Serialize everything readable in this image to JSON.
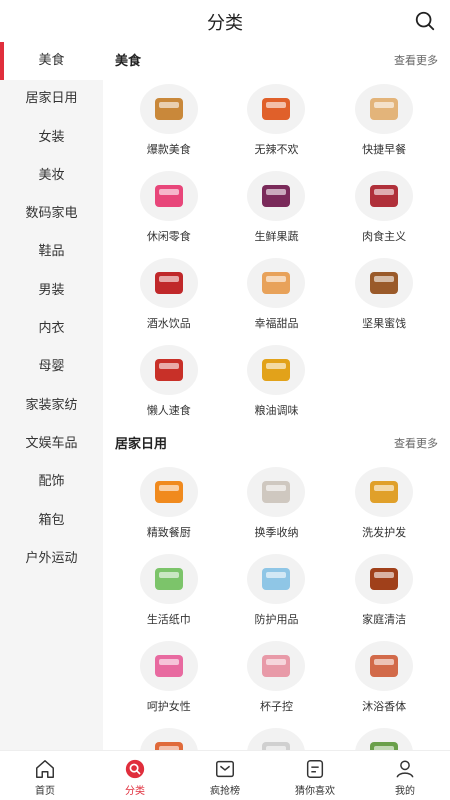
{
  "header": {
    "title": "分类"
  },
  "sidebar": {
    "items": [
      {
        "label": "美食",
        "active": true
      },
      {
        "label": "居家日用"
      },
      {
        "label": "女装"
      },
      {
        "label": "美妆"
      },
      {
        "label": "数码家电"
      },
      {
        "label": "鞋品"
      },
      {
        "label": "男装"
      },
      {
        "label": "内衣"
      },
      {
        "label": "母婴"
      },
      {
        "label": "家装家纺"
      },
      {
        "label": "文娱车品"
      },
      {
        "label": "配饰"
      },
      {
        "label": "箱包"
      },
      {
        "label": "户外运动"
      }
    ]
  },
  "sections": [
    {
      "title": "美食",
      "more": "查看更多",
      "items": [
        {
          "label": "爆款美食",
          "icon": "snack-bags-icon",
          "color": "#c9883a"
        },
        {
          "label": "无辣不欢",
          "icon": "spicy-meat-icon",
          "color": "#e0602a"
        },
        {
          "label": "快捷早餐",
          "icon": "bread-icon",
          "color": "#e3b47a"
        },
        {
          "label": "休闲零食",
          "icon": "chips-bag-icon",
          "color": "#e8467a"
        },
        {
          "label": "生鲜果蔬",
          "icon": "fruit-icon",
          "color": "#7a2a5a"
        },
        {
          "label": "肉食主义",
          "icon": "meat-box-icon",
          "color": "#b0303a"
        },
        {
          "label": "酒水饮品",
          "icon": "bottles-icon",
          "color": "#c0282a"
        },
        {
          "label": "幸福甜品",
          "icon": "macaron-box-icon",
          "color": "#e8a25a"
        },
        {
          "label": "坚果蜜饯",
          "icon": "nuts-box-icon",
          "color": "#9a5a2a"
        },
        {
          "label": "懒人速食",
          "icon": "instant-noodles-icon",
          "color": "#c83028"
        },
        {
          "label": "粮油调味",
          "icon": "oil-bottle-icon",
          "color": "#e2a21a"
        }
      ]
    },
    {
      "title": "居家日用",
      "more": "查看更多",
      "items": [
        {
          "label": "精致餐厨",
          "icon": "pot-icon",
          "color": "#f08a1e"
        },
        {
          "label": "换季收纳",
          "icon": "drawer-icon",
          "color": "#cfc8c0"
        },
        {
          "label": "洗发护发",
          "icon": "shampoo-icon",
          "color": "#e0a02a"
        },
        {
          "label": "生活纸巾",
          "icon": "tissue-icon",
          "color": "#7cc46a"
        },
        {
          "label": "防护用品",
          "icon": "mask-icon",
          "color": "#8fc6e6"
        },
        {
          "label": "家庭清洁",
          "icon": "disinfectant-icon",
          "color": "#a0401a"
        },
        {
          "label": "呵护女性",
          "icon": "pad-pack-icon",
          "color": "#e86aa0"
        },
        {
          "label": "杯子控",
          "icon": "cup-icon",
          "color": "#e89aa8"
        },
        {
          "label": "沐浴香体",
          "icon": "perfume-icon",
          "color": "#d26a4a"
        },
        {
          "label": "",
          "icon": "spray-icon",
          "color": "#e06a3a"
        },
        {
          "label": "",
          "icon": "cup2-icon",
          "color": "#d0d0d0"
        },
        {
          "label": "",
          "icon": "bottles2-icon",
          "color": "#6aa04a"
        }
      ]
    }
  ],
  "tabbar": {
    "items": [
      {
        "label": "首页",
        "icon": "home-icon"
      },
      {
        "label": "分类",
        "icon": "category-icon",
        "active": true
      },
      {
        "label": "疯抢榜",
        "icon": "ranking-icon"
      },
      {
        "label": "猜你喜欢",
        "icon": "guess-like-icon"
      },
      {
        "label": "我的",
        "icon": "profile-icon"
      }
    ]
  },
  "colors": {
    "accent": "#e02e3c",
    "sidebar_bg": "#f5f5f5"
  }
}
